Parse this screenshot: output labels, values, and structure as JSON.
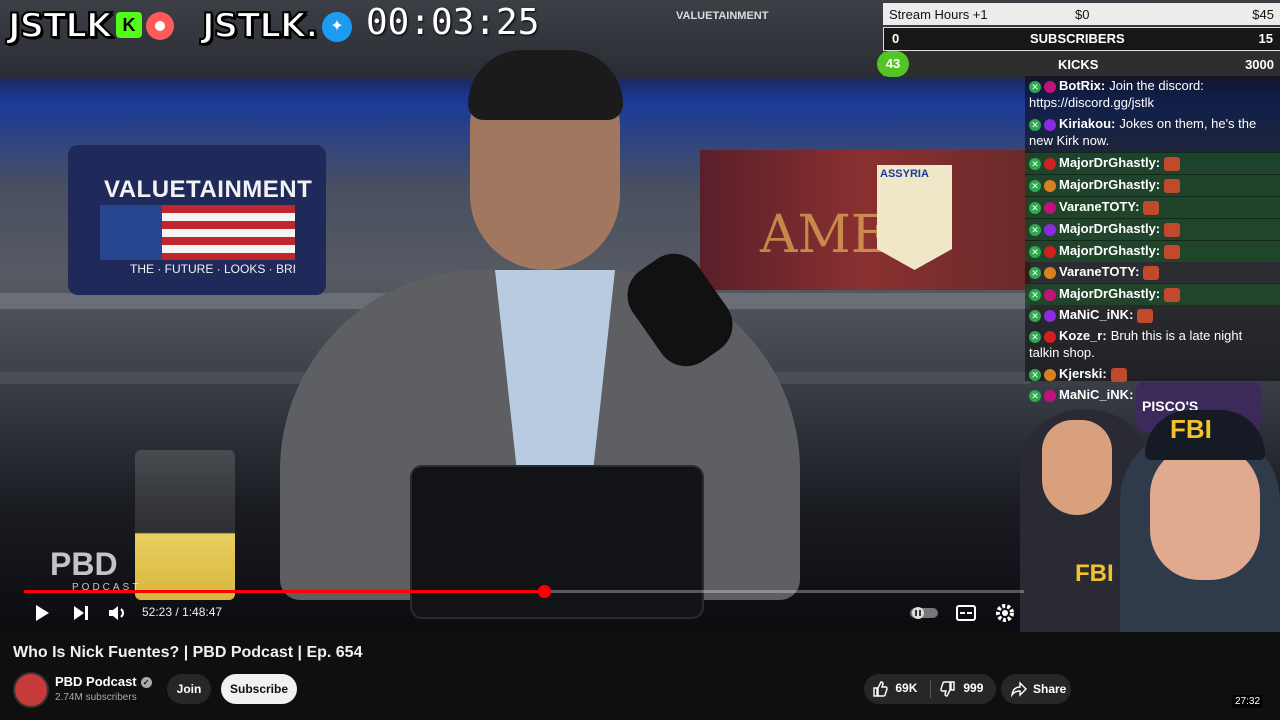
{
  "overlay": {
    "brand_left": "JSTLK",
    "kick_badge": "K",
    "brand_right": "JSTLK.",
    "timer": "00:03:25",
    "shelf_sign": "VALUETAINMENT"
  },
  "goals": {
    "stream_hours_label": "Stream Hours +1",
    "stream_hours_amount": "$0",
    "stream_hours_goal": "$45",
    "subscribers_current": "0",
    "subscribers_label": "SUBSCRIBERS",
    "subscribers_goal": "15",
    "kicks_current": "43",
    "kicks_label": "KICKS",
    "kicks_goal": "3000",
    "kicks_progress": 0.014
  },
  "chat": [
    {
      "user": "BotRix:",
      "text": "Join the discord: https://discord.gg/jstlk",
      "emote": false,
      "highlight": false
    },
    {
      "user": "Kiriakou:",
      "text": "Jokes on them, he's the new Kirk now.",
      "emote": false,
      "highlight": false
    },
    {
      "user": "MajorDrGhastly:",
      "text": "",
      "emote": true,
      "highlight": true
    },
    {
      "user": "MajorDrGhastly:",
      "text": "",
      "emote": true,
      "highlight": true
    },
    {
      "user": "VaraneTOTY:",
      "text": "",
      "emote": true,
      "highlight": true
    },
    {
      "user": "MajorDrGhastly:",
      "text": "",
      "emote": true,
      "highlight": true
    },
    {
      "user": "MajorDrGhastly:",
      "text": "",
      "emote": true,
      "highlight": true
    },
    {
      "user": "VaraneTOTY:",
      "text": "",
      "emote": true,
      "highlight": false
    },
    {
      "user": "MajorDrGhastly:",
      "text": "",
      "emote": true,
      "highlight": true
    },
    {
      "user": "MaNiC_iNK:",
      "text": "",
      "emote": true,
      "highlight": false
    },
    {
      "user": "Koze_r:",
      "text": "Bruh this is a late night talkin shop.",
      "emote": false,
      "highlight": false
    },
    {
      "user": "Kjerski:",
      "text": "",
      "emote": true,
      "highlight": false
    },
    {
      "user": "MaNiC_iNK:",
      "text": "",
      "emote": true,
      "highlight": false
    }
  ],
  "scene": {
    "pillow_text": "VALUETAINMENT",
    "pillow_sub": "THE · FUTURE · LOOKS · BRI",
    "banner_text": "AME   A",
    "pennant_text": "ASSYRIA",
    "pbd_logo": "PBD",
    "pbd_sub": "PODCAST",
    "piscos": "PISCO'S",
    "fbi_cap": "FBI",
    "fbi_shirt": "FBI"
  },
  "player": {
    "time_current": "52:23",
    "time_total": "1:48:47",
    "time_display": "52:23 / 1:48:47",
    "progress": 0.52,
    "accent": "#ff0000"
  },
  "video_info": {
    "title": "Who Is Nick Fuentes? | PBD Podcast | Ep. 654",
    "channel": "PBD Podcast",
    "subscribers": "2.74M subscribers",
    "join_label": "Join",
    "subscribe_label": "Subscribe",
    "likes": "69K",
    "dislikes": "999",
    "share_label": "Share",
    "side_duration": "27:32"
  },
  "icons": [
    "play-icon",
    "next-icon",
    "volume-icon",
    "pause-toggle-icon",
    "subtitles-icon",
    "settings-icon",
    "like-icon",
    "dislike-icon",
    "share-icon",
    "verified-icon"
  ]
}
